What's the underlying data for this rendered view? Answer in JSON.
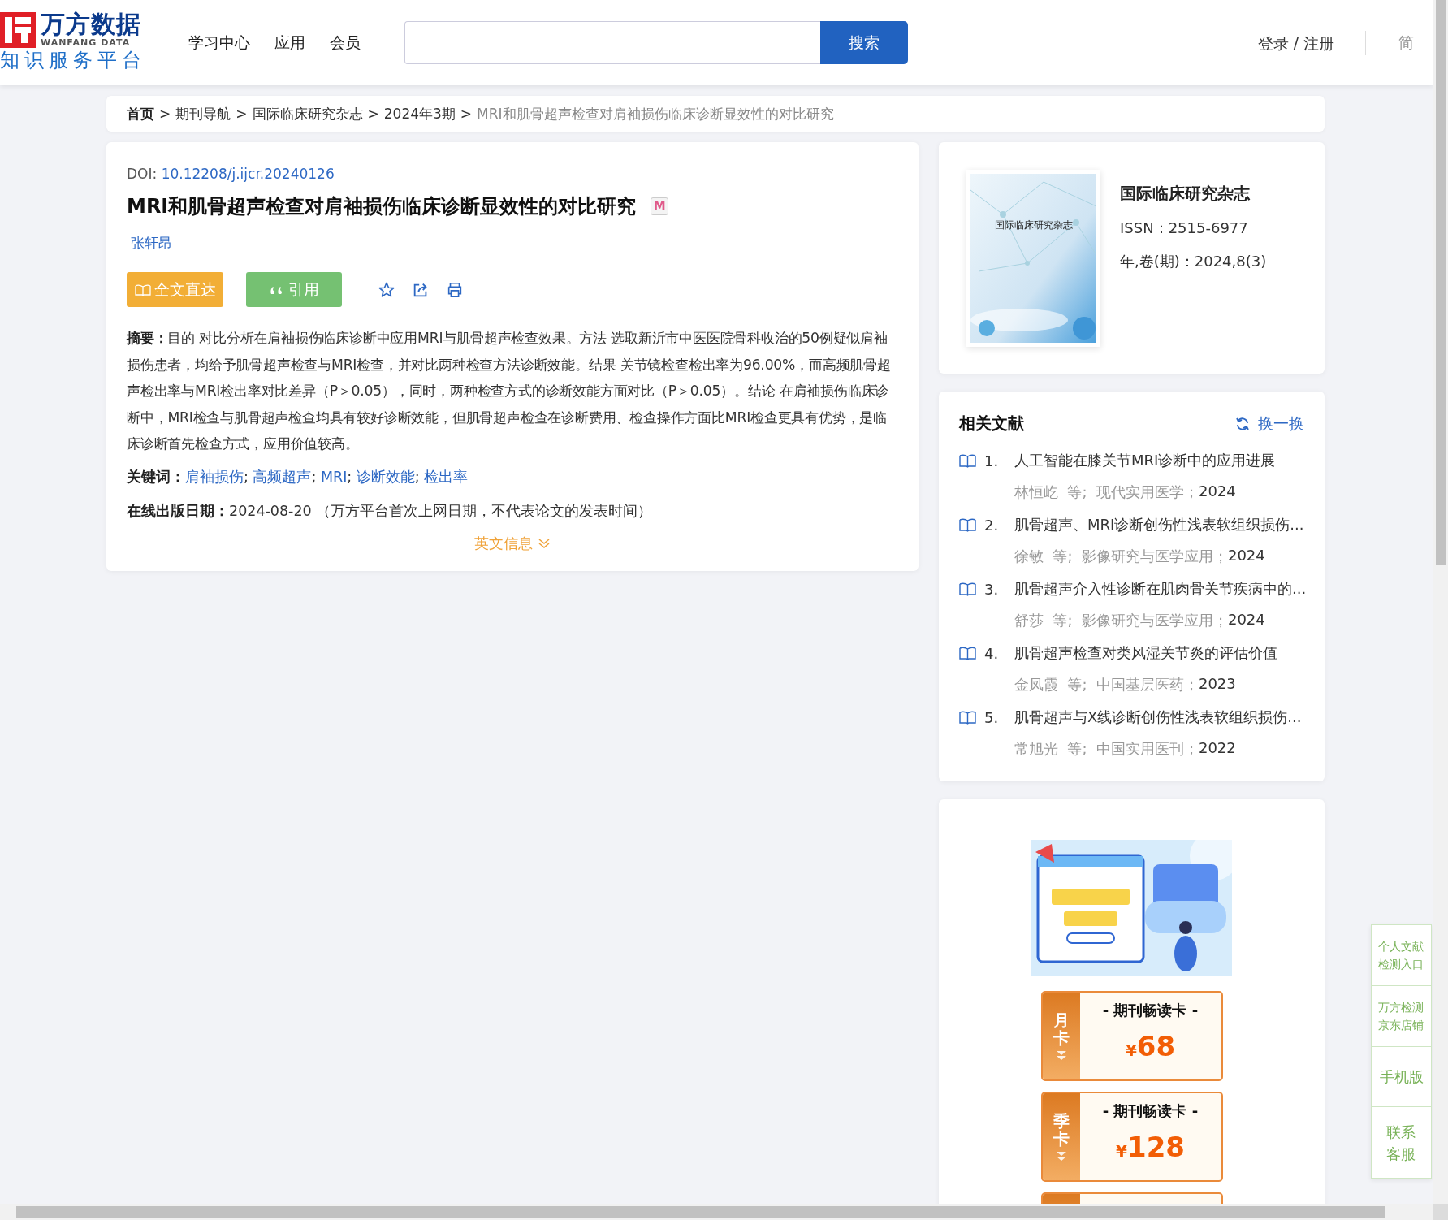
{
  "header": {
    "logo": {
      "name": "万方数据",
      "latin": "WANFANG DATA",
      "tagline": "知识服务平台"
    },
    "nav": [
      {
        "label": "学习中心"
      },
      {
        "label": "应用"
      },
      {
        "label": "会员"
      }
    ],
    "search": {
      "button": "搜索"
    },
    "account": "登录 / 注册",
    "language": "简"
  },
  "breadcrumb": [
    {
      "label": "首页",
      "kind": "home",
      "separator": ">"
    },
    {
      "label": "期刊导航",
      "kind": "link",
      "separator": ">"
    },
    {
      "label": "国际临床研究杂志",
      "kind": "link",
      "separator": ">"
    },
    {
      "label": "2024年3期",
      "kind": "link",
      "separator": ">"
    },
    {
      "label": "MRI和肌骨超声检查对肩袖损伤临床诊断显效性的对比研究",
      "kind": "current"
    }
  ],
  "article": {
    "doi_label": "DOI:",
    "doi": "10.12208/j.ijcr.20240126",
    "title": "MRI和肌骨超声检查对肩袖损伤临床诊断显效性的对比研究",
    "badge": "M",
    "authors": [
      "张轩昂"
    ],
    "actions": [
      {
        "label": "全文直达",
        "kind": "fulltext"
      },
      {
        "label": "引用",
        "kind": "cite"
      }
    ],
    "abstract": {
      "label": "摘要：",
      "text": "目的 对比分析在肩袖损伤临床诊断中应用MRI与肌骨超声检查效果。方法 选取新沂市中医医院骨科收治的50例疑似肩袖损伤患者，均给予肌骨超声检查与MRI检查，并对比两种检查方法诊断效能。结果 关节镜检查检出率为96.00%，而高频肌骨超声检出率与MRI检出率对比差异（P＞0.05），同时，两种检查方式的诊断效能方面对比（P＞0.05）。结论 在肩袖损伤临床诊断中，MRI检查与肌骨超声检查均具有较好诊断效能，但肌骨超声检查在诊断费用、检查操作方面比MRI检查更具有优势，是临床诊断首先检查方式，应用价值较高。"
    },
    "keywords": {
      "label": "关键词：",
      "items": [
        {
          "label": "肩袖损伤",
          "separator": ";"
        },
        {
          "label": "高频超声",
          "separator": ";"
        },
        {
          "label": "MRI",
          "separator": ";"
        },
        {
          "label": "诊断效能",
          "separator": ";"
        },
        {
          "label": "检出率"
        }
      ]
    },
    "online_date": {
      "label": "在线出版日期：",
      "date": "2024-08-20",
      "note": "（万方平台首次上网日期，不代表论文的发表时间）"
    },
    "english_toggle": {
      "label": "英文信息",
      "expanded": false
    }
  },
  "journal": {
    "cover_title": "国际临床研究杂志",
    "name": "国际临床研究杂志",
    "issn": "ISSN：2515-6977",
    "issue": "年,卷(期)：2024,8(3)"
  },
  "related": {
    "title": "相关文献",
    "refresh": "换一换",
    "items": [
      {
        "number": "1.",
        "title": "人工智能在膝关节MRI诊断中的应用进展",
        "source": "林恒屹  等;  现代实用医学；",
        "year": "2024"
      },
      {
        "number": "2.",
        "title": "肌骨超声、MRI诊断创伤性浅表软组织损伤...",
        "source": "徐敏  等;  影像研究与医学应用；",
        "year": "2024"
      },
      {
        "number": "3.",
        "title": "肌骨超声介入性诊断在肌肉骨关节疾病中的...",
        "source": "舒莎  等;  影像研究与医学应用；",
        "year": "2024"
      },
      {
        "number": "4.",
        "title": "肌骨超声检查对类风湿关节炎的评估价值",
        "source": "金凤霞  等;  中国基层医药；",
        "year": "2023"
      },
      {
        "number": "5.",
        "title": "肌骨超声与X线诊断创伤性浅表软组织损伤...",
        "source": "常旭光  等;  中国实用医刊；",
        "year": "2022"
      }
    ]
  },
  "promo": {
    "cards": [
      {
        "period": "月卡",
        "title": "- 期刊畅读卡 -",
        "currency": "¥",
        "price": "68"
      },
      {
        "period": "季卡",
        "title": "- 期刊畅读卡 -",
        "currency": "¥",
        "price": "128"
      }
    ]
  },
  "side_panel": [
    {
      "label": "个人文献检测入口",
      "kind": "small"
    },
    {
      "label": "万方检测京东店铺",
      "kind": "small"
    },
    {
      "label": "手机版",
      "kind": "wide"
    },
    {
      "label": "联系客服",
      "kind": "narrow"
    }
  ]
}
